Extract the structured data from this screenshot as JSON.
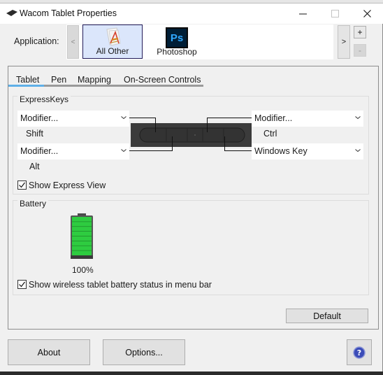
{
  "window": {
    "title": "Wacom Tablet Properties",
    "controls": {
      "minimize": "minimize",
      "maximize": "maximize",
      "close": "close"
    }
  },
  "application": {
    "label": "Application:",
    "prev": "<",
    "next": ">",
    "add": "+",
    "remove": "-",
    "apps": [
      {
        "name": "All Other",
        "selected": true,
        "icon": "all-other-icon"
      },
      {
        "name": "Photoshop",
        "selected": false,
        "icon": "photoshop-icon",
        "icon_text": "Ps"
      }
    ]
  },
  "tabs": [
    {
      "label": "Tablet",
      "active": true
    },
    {
      "label": "Pen",
      "active": false
    },
    {
      "label": "Mapping",
      "active": false
    },
    {
      "label": "On-Screen Controls",
      "active": false
    }
  ],
  "expresskeys": {
    "title": "ExpressKeys",
    "left": [
      {
        "value": "Modifier...",
        "sub": "Shift"
      },
      {
        "value": "Modifier...",
        "sub": "Alt"
      }
    ],
    "right": [
      {
        "value": "Modifier...",
        "sub": "Ctrl"
      },
      {
        "value": "Windows Key",
        "sub": ""
      }
    ],
    "show_express_view": {
      "label": "Show Express View",
      "checked": true
    }
  },
  "battery": {
    "title": "Battery",
    "level_percent": 100,
    "level_text": "100%",
    "show_status": {
      "label": "Show wireless tablet battery status in menu bar",
      "checked": true
    }
  },
  "buttons": {
    "default": "Default",
    "about": "About",
    "options": "Options...",
    "help": "help"
  },
  "colors": {
    "accent_tab": "#5fb0e8",
    "selected_tile_bg": "#dbe6fb",
    "battery_green": "#2ecc40",
    "photoshop_bg": "#001e36",
    "photoshop_fg": "#31a8ff"
  }
}
